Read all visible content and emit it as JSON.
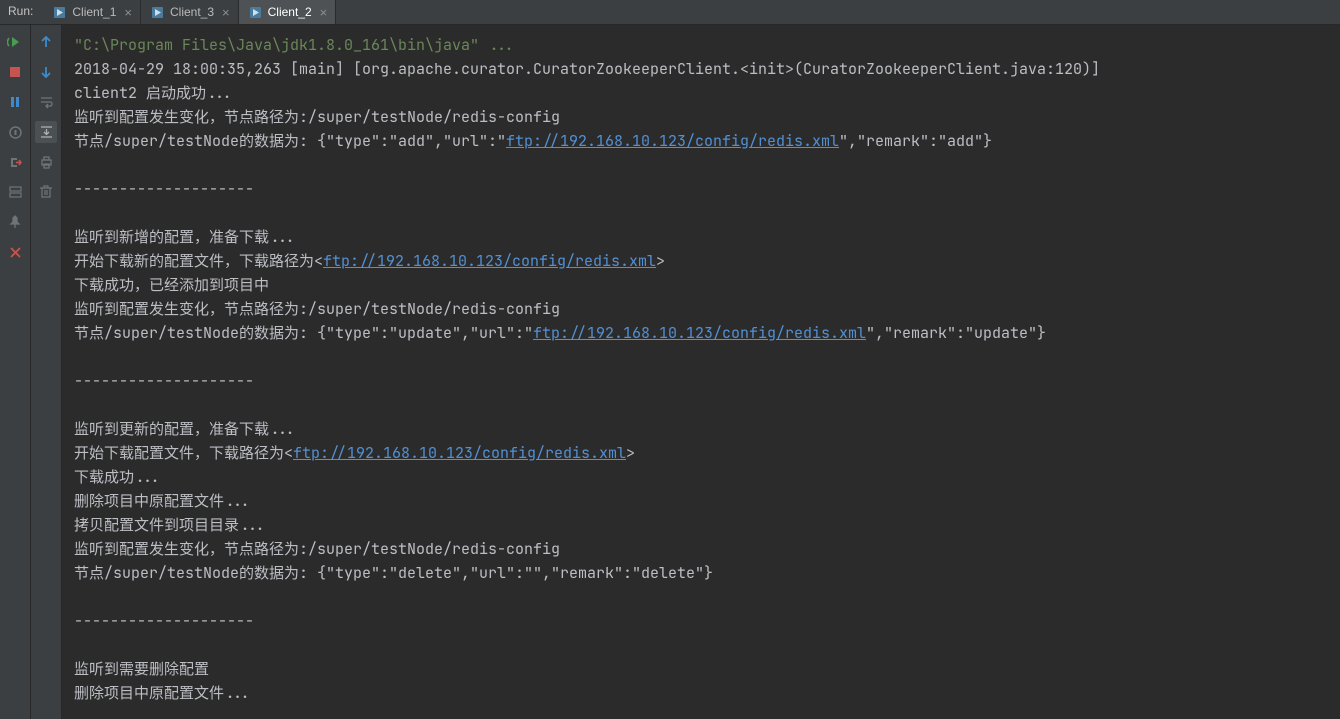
{
  "header": {
    "run_label": "Run:",
    "tabs": [
      {
        "label": "Client_1",
        "active": false
      },
      {
        "label": "Client_3",
        "active": false
      },
      {
        "label": "Client_2",
        "active": true
      }
    ]
  },
  "console": {
    "cmd": "\"C:\\Program Files\\Java\\jdk1.8.0_161\\bin\\java\" ...",
    "log_line": "2018-04-29 18:00:35,263 [main] [org.apache.curator.CuratorZookeeperClient.<init>(CuratorZookeeperClient.java:120)]",
    "start_line": "client2 启动成功...",
    "l4": "监听到配置发生变化，节点路径为:/super/testNode/redis-config",
    "l5_pre": "节点/super/testNode的数据为: {\"type\":\"add\",\"url\":\"",
    "l5_url": "ftp://192.168.10.123/config/redis.xml",
    "l5_post": "\",\"remark\":\"add\"}",
    "sep": "--------------------",
    "l7": "监听到新增的配置，准备下载...",
    "l8_pre": "开始下载新的配置文件，下载路径为<",
    "l8_url": "ftp://192.168.10.123/config/redis.xml",
    "l8_post": ">",
    "l9": "下载成功，已经添加到项目中",
    "l10": "监听到配置发生变化，节点路径为:/super/testNode/redis-config",
    "l11_pre": "节点/super/testNode的数据为: {\"type\":\"update\",\"url\":\"",
    "l11_url": "ftp://192.168.10.123/config/redis.xml",
    "l11_post": "\",\"remark\":\"update\"}",
    "l13": "监听到更新的配置，准备下载...",
    "l14_pre": "开始下载配置文件，下载路径为<",
    "l14_url": "ftp://192.168.10.123/config/redis.xml",
    "l14_post": ">",
    "l15": "下载成功...",
    "l16": "删除项目中原配置文件...",
    "l17": "拷贝配置文件到项目目录...",
    "l18": "监听到配置发生变化，节点路径为:/super/testNode/redis-config",
    "l19": "节点/super/testNode的数据为: {\"type\":\"delete\",\"url\":\"\",\"remark\":\"delete\"}",
    "l21": "监听到需要删除配置",
    "l22": "删除项目中原配置文件..."
  }
}
